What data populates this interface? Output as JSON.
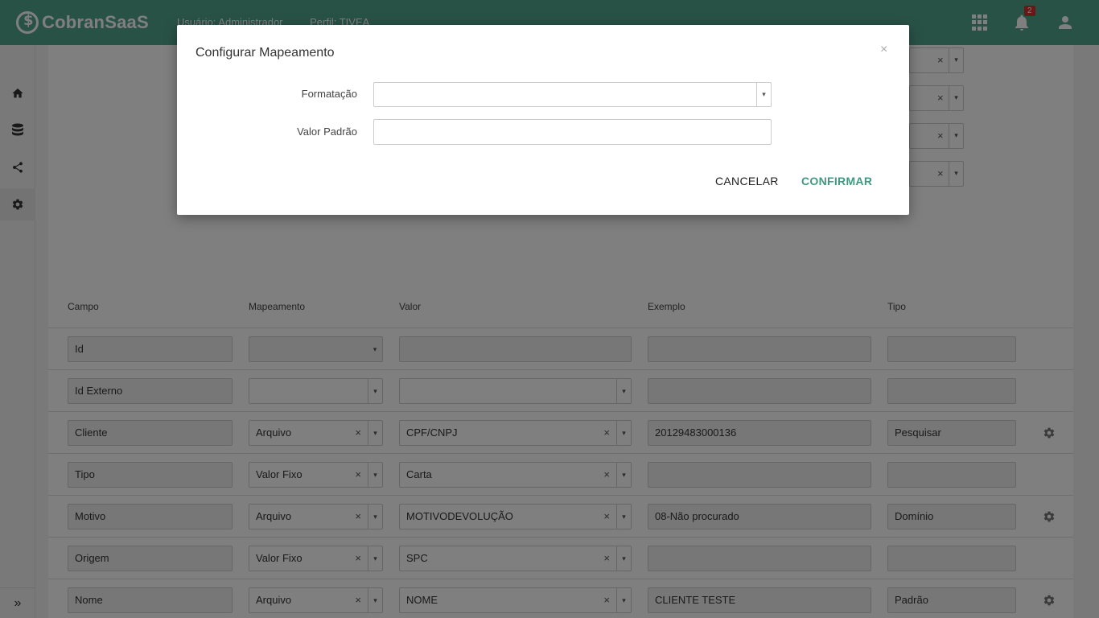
{
  "app": {
    "logo_text": "CobranSaaS",
    "user_label": "Usuário: Administrador",
    "profile_label": "Perfil: TIVEA",
    "notification_count": "2"
  },
  "sidebar": {
    "items": [
      {
        "icon": "home-icon"
      },
      {
        "icon": "database-icon"
      },
      {
        "icon": "share-icon"
      },
      {
        "icon": "gear-icon"
      }
    ],
    "expand_label": "»"
  },
  "table": {
    "headers": {
      "campo": "Campo",
      "mapeamento": "Mapeamento",
      "valor": "Valor",
      "exemplo": "Exemplo",
      "tipo": "Tipo"
    },
    "rows": [
      {
        "campo": "Id",
        "mapeamento": "",
        "valor": "",
        "exemplo": "",
        "tipo": "",
        "settings": false
      },
      {
        "campo": "Id Externo",
        "mapeamento": "",
        "valor": "",
        "exemplo": "",
        "tipo": "",
        "settings": false
      },
      {
        "campo": "Cliente",
        "mapeamento": "Arquivo",
        "valor": "CPF/CNPJ",
        "exemplo": "20129483000136",
        "tipo": "Pesquisar",
        "settings": true
      },
      {
        "campo": "Tipo",
        "mapeamento": "Valor Fixo",
        "valor": "Carta",
        "exemplo": "",
        "tipo": "",
        "settings": false
      },
      {
        "campo": "Motivo",
        "mapeamento": "Arquivo",
        "valor": "MOTIVODEVOLUÇÃO",
        "exemplo": "08-Não procurado",
        "tipo": "Domínio",
        "settings": true
      },
      {
        "campo": "Origem",
        "mapeamento": "Valor Fixo",
        "valor": "SPC",
        "exemplo": "",
        "tipo": "",
        "settings": false
      },
      {
        "campo": "Nome",
        "mapeamento": "Arquivo",
        "valor": "NOME",
        "exemplo": "CLIENTE TESTE",
        "tipo": "Padrão",
        "settings": true
      }
    ]
  },
  "modal": {
    "title": "Configurar Mapeamento",
    "close": "×",
    "formatacao_label": "Formatação",
    "formatacao_value": "",
    "valor_padrao_label": "Valor Padrão",
    "valor_padrao_value": "",
    "cancel_label": "CANCELAR",
    "confirm_label": "CONFIRMAR"
  },
  "glyphs": {
    "clear": "×",
    "caret": "▾"
  }
}
